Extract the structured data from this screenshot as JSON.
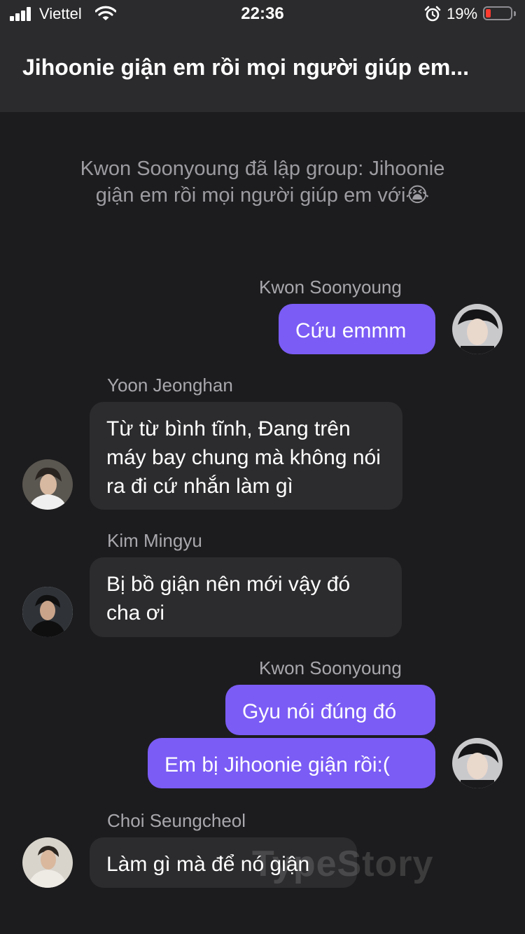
{
  "status": {
    "carrier": "Viettel",
    "time": "22:36",
    "battery": "19%",
    "battery_level": 0.19,
    "icons": [
      "signal-icon",
      "wifi-icon",
      "alarm-icon",
      "battery-icon"
    ]
  },
  "header": {
    "title": "Jihoonie giận em rồi mọi người giúp em..."
  },
  "system_message": "Kwon Soonyoung đã lập group: Jihoonie giận em rồi mọi người giúp em với😭",
  "messages": [
    {
      "sender": "Kwon Soonyoung",
      "direction": "outgoing",
      "text": "Cứu emmm"
    },
    {
      "sender": "Yoon Jeonghan",
      "direction": "incoming",
      "text": "Từ từ bình tĩnh, Đang trên máy bay chung mà không nói ra đi cứ nhắn làm gì"
    },
    {
      "sender": "Kim Mingyu",
      "direction": "incoming",
      "text": "Bị bồ giận nên mới vậy đó cha ơi"
    },
    {
      "sender": "Kwon Soonyoung",
      "direction": "outgoing",
      "text": "Gyu nói đúng đó"
    },
    {
      "sender": "Kwon Soonyoung",
      "direction": "outgoing",
      "text": "Em bị Jihoonie giận rồi:("
    },
    {
      "sender": "Choi Seungcheol",
      "direction": "incoming",
      "text": "Làm gì mà để nó giận"
    }
  ],
  "watermark": "TypeStory",
  "colors": {
    "background": "#1c1c1e",
    "header": "#2b2b2d",
    "outgoing_bubble": "#7b5cf5",
    "incoming_bubble": "#2c2c2e",
    "name_text": "#a8a8ad",
    "system_text": "#9c9ca1"
  }
}
